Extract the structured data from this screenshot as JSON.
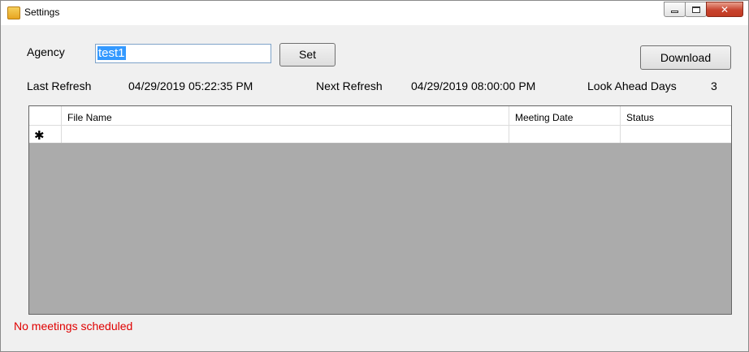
{
  "window": {
    "title": "Settings",
    "icon": "app-icon",
    "controls": {
      "minimize": "minimize-icon",
      "maximize": "maximize-icon",
      "close": "close-icon",
      "close_glyph": "✕"
    }
  },
  "form": {
    "agency_label": "Agency",
    "agency_value": "test1",
    "set_label": "Set",
    "download_label": "Download",
    "last_refresh_label": "Last Refresh",
    "last_refresh_value": "04/29/2019 05:22:35 PM",
    "next_refresh_label": "Next Refresh",
    "next_refresh_value": "04/29/2019 08:00:00 PM",
    "look_ahead_label": "Look Ahead Days",
    "look_ahead_value": "3"
  },
  "grid": {
    "columns": [
      "File Name",
      "Meeting Date",
      "Status"
    ],
    "new_row_marker": "✱"
  },
  "status_message": "No meetings scheduled",
  "colors": {
    "status_error": "#e00000",
    "grid_background": "#ababab",
    "selection": "#3399ff"
  }
}
